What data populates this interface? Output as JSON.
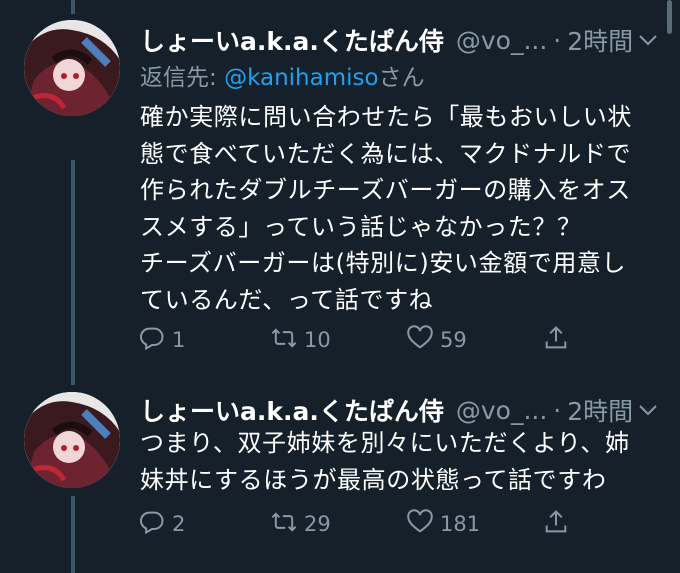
{
  "tweets": [
    {
      "display_name": "しょーいa.k.a.くたぱん侍",
      "handle": "@vo_...",
      "separator": "·",
      "time": "2時間",
      "reply_label": "返信先:",
      "reply_mention": "@kanihamiso",
      "reply_suffix": "さん",
      "body": "確か実際に問い合わせたら「最もおいしい状\n態で食べていただく為には、マクドナルドで\n作られたダブルチーズバーガーの購入をオス\nスメする」っていう話じゃなかった？？\nチーズバーガーは(特別に)安い金額で用意し\nているんだ、って話ですね",
      "replies": "1",
      "retweets": "10",
      "likes": "59"
    },
    {
      "display_name": "しょーいa.k.a.くたぱん侍",
      "handle": "@vo_...",
      "separator": "·",
      "time": "2時間",
      "body": "つまり、双子姉妹を別々にいただくより、姉\n妹丼にするほうが最高の状態って話ですわ",
      "replies": "2",
      "retweets": "29",
      "likes": "181"
    }
  ],
  "icons": {
    "reply": "reply-icon",
    "retweet": "retweet-icon",
    "like": "heart-icon",
    "share": "share-icon",
    "caret": "chevron-down-icon"
  },
  "colors": {
    "background": "#15202b",
    "text": "#ffffff",
    "secondary": "#8899a6",
    "accent": "#1da1f2",
    "thread_line": "#3d5466"
  }
}
